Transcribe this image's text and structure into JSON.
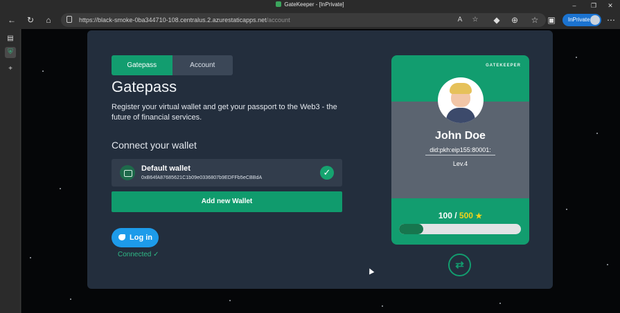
{
  "browser": {
    "title": "GateKeeper - [InPrivate]",
    "url_base": "https://black-smoke-0ba344710-108.centralus.2.azurestaticapps.net",
    "url_path": "/account",
    "inprivate_label": "InPrivate"
  },
  "tabs": {
    "gatepass": "Gatepass",
    "account": "Account"
  },
  "main": {
    "title": "Gatepass",
    "description": "Register your virtual wallet and get your passport to the Web3 - the future of financial services.",
    "connect_heading": "Connect your wallet"
  },
  "wallet": {
    "name": "Default wallet",
    "address": "0xB64fA87685621C1b09e0336807b9EDFFb5eCBBdA"
  },
  "buttons": {
    "add_wallet": "Add new Wallet",
    "login": "Log in"
  },
  "status": {
    "connected": "Connected ✓"
  },
  "card": {
    "brand": "GATEKEEPER",
    "name": "John Doe",
    "did": "did:pkh:eip155:80001:",
    "level": "Lev.4",
    "points_current": "100",
    "points_separator": "/",
    "points_max": "500",
    "progress_fraction": 0.2
  },
  "colors": {
    "accent": "#129d6f",
    "panel": "#232e3d",
    "twitter": "#1d9bea",
    "gold": "#f2d21b"
  },
  "icons": {
    "wallet": "wallet-icon",
    "check": "check-icon",
    "twitter": "twitter-icon",
    "swap": "swap-arrows-icon",
    "star": "star-icon"
  }
}
